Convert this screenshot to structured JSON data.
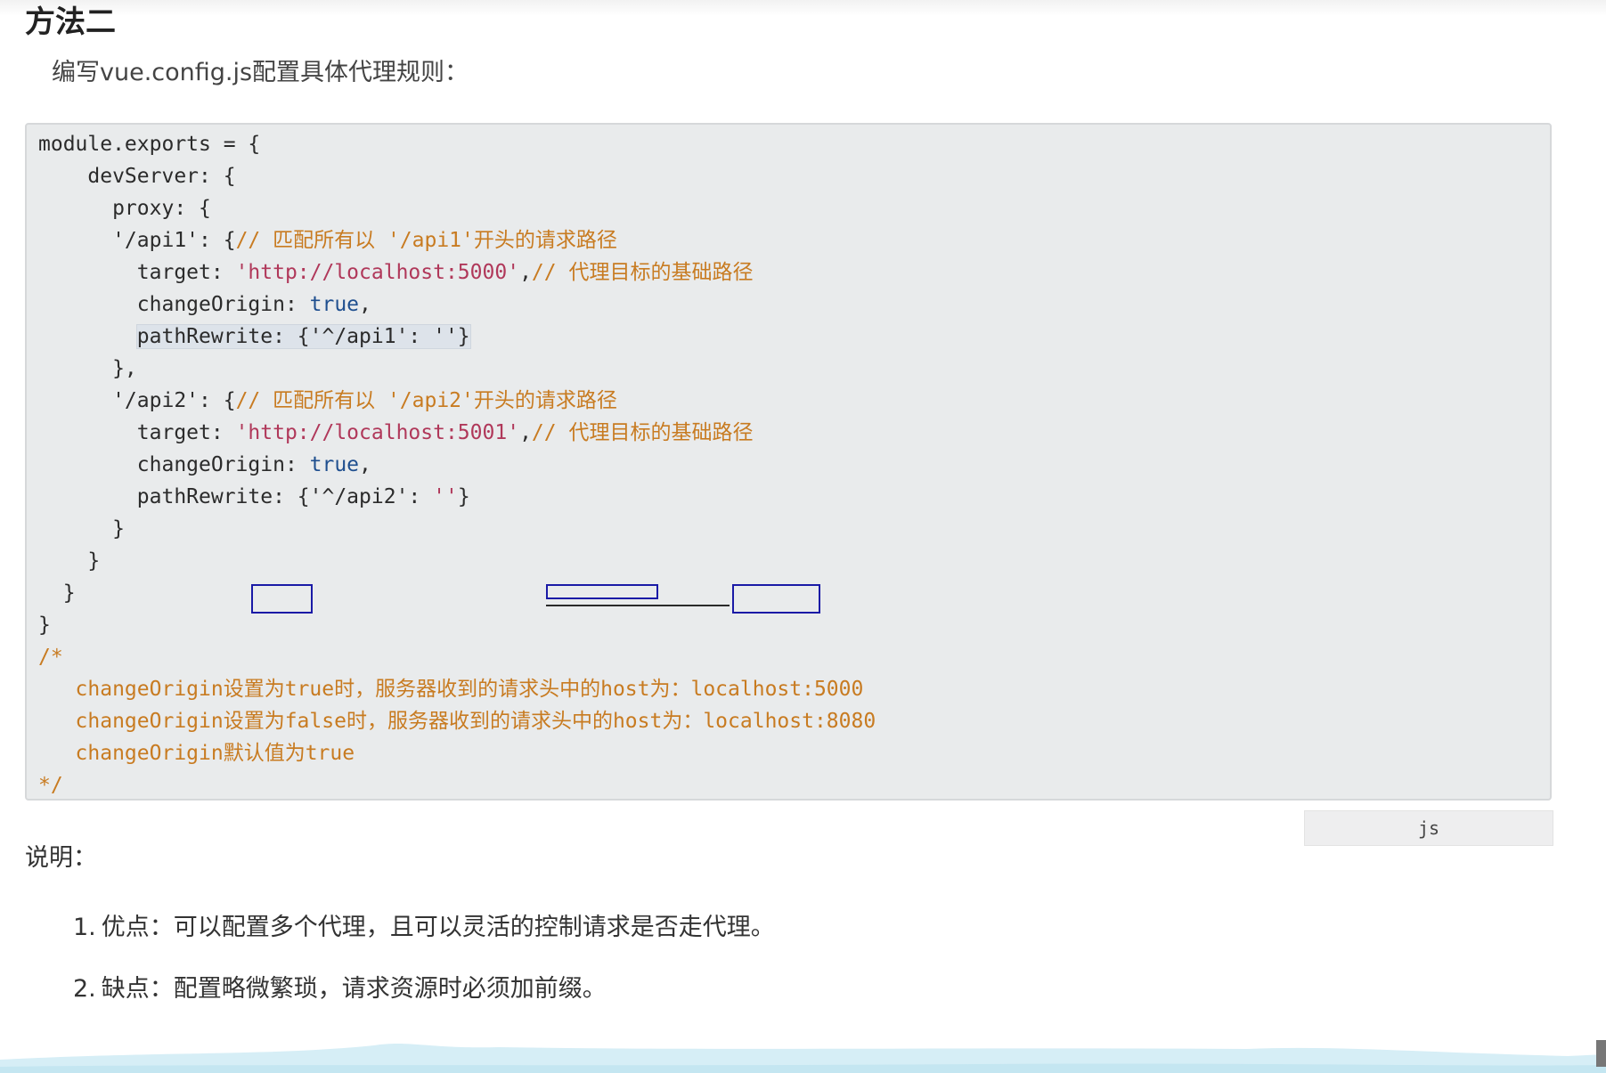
{
  "heading": "方法二",
  "intro": "编写vue.config.js配置具体代理规则：",
  "code": {
    "language": "js",
    "lines": [
      [
        {
          "t": "module.exports = {",
          "c": "plain"
        }
      ],
      [
        {
          "t": "    devServer: {",
          "c": "plain"
        }
      ],
      [
        {
          "t": "      proxy: {",
          "c": "plain"
        }
      ],
      [
        {
          "t": "      '/api1': {",
          "c": "plain"
        },
        {
          "t": "// 匹配所有以 '/api1'开头的请求路径",
          "c": "comment"
        }
      ],
      [
        {
          "t": "        target: ",
          "c": "plain"
        },
        {
          "t": "'http://localhost:5000'",
          "c": "string"
        },
        {
          "t": ",",
          "c": "plain"
        },
        {
          "t": "// 代理目标的基础路径",
          "c": "comment"
        }
      ],
      [
        {
          "t": "        changeOrigin: ",
          "c": "plain"
        },
        {
          "t": "true",
          "c": "keyword"
        },
        {
          "t": ",",
          "c": "plain"
        }
      ],
      [
        {
          "t": "        ",
          "c": "plain"
        },
        {
          "t": "pathRewrite: {'^/api1': ''}",
          "c": "highlight"
        }
      ],
      [
        {
          "t": "      },",
          "c": "plain"
        }
      ],
      [
        {
          "t": "      '/api2': {",
          "c": "plain"
        },
        {
          "t": "// 匹配所有以 '/api2'开头的请求路径",
          "c": "comment"
        }
      ],
      [
        {
          "t": "        target: ",
          "c": "plain"
        },
        {
          "t": "'http://localhost:5001'",
          "c": "string"
        },
        {
          "t": ",",
          "c": "plain"
        },
        {
          "t": "// 代理目标的基础路径",
          "c": "comment"
        }
      ],
      [
        {
          "t": "        changeOrigin: ",
          "c": "plain"
        },
        {
          "t": "true",
          "c": "keyword"
        },
        {
          "t": ",",
          "c": "plain"
        }
      ],
      [
        {
          "t": "        pathRewrite: {'^/api2': ",
          "c": "plain"
        },
        {
          "t": "''",
          "c": "string"
        },
        {
          "t": "}",
          "c": "plain"
        }
      ],
      [
        {
          "t": "      }",
          "c": "plain"
        }
      ],
      [
        {
          "t": "    }",
          "c": "plain"
        }
      ],
      [
        {
          "t": "  }",
          "c": "plain"
        }
      ],
      [
        {
          "t": "}",
          "c": "plain"
        }
      ],
      [
        {
          "t": "/*",
          "c": "comment"
        }
      ],
      [
        {
          "t": "   changeOrigin设置为true时，服务器收到的请求头中的host为：localhost:5000",
          "c": "comment"
        }
      ],
      [
        {
          "t": "   changeOrigin设置为false时，服务器收到的请求头中的host为：localhost:8080",
          "c": "comment"
        }
      ],
      [
        {
          "t": "   changeOrigin默认值为true",
          "c": "comment"
        }
      ],
      [
        {
          "t": "*/",
          "c": "comment"
        }
      ]
    ]
  },
  "notes": {
    "title": "说明：",
    "items": [
      {
        "num": "1.",
        "text": "优点：可以配置多个代理，且可以灵活的控制请求是否走代理。"
      },
      {
        "num": "2.",
        "text": "缺点：配置略微繁琐，请求资源时必须加前缀。"
      }
    ]
  },
  "colors": {
    "code_background": "#e9ebec",
    "comment": "#c87b21",
    "string": "#b0385a",
    "keyword": "#1f4f8f",
    "annotation_box": "#1a1aa6"
  }
}
